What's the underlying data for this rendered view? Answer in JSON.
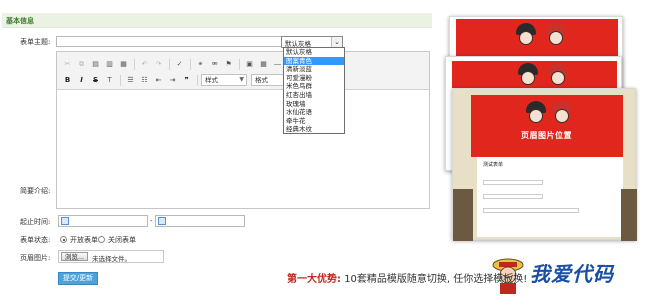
{
  "section": {
    "title": "基本信息"
  },
  "labels": {
    "form_title": "表单主题:",
    "intro": "简要介绍:",
    "time": "起止时间:",
    "status": "表单状态:",
    "header_image": "页眉图片:"
  },
  "theme_select": {
    "value": "默认灰格",
    "options": [
      "默认灰格",
      "图案青色",
      "清新淡蓝",
      "可爱漫粉",
      "米色鸟群",
      "红杏出墙",
      "玫瑰墙",
      "水仙花语",
      "牵牛花",
      "经典木纹"
    ],
    "highlighted_index": 1
  },
  "editor": {
    "style_combo": "样式",
    "format_combo": "格式",
    "font_color_label": "A"
  },
  "date_separator": "-",
  "status_options": [
    {
      "label": "开放表单",
      "checked": true
    },
    {
      "label": "关闭表单",
      "checked": false
    }
  ],
  "file": {
    "button": "浏览...",
    "no_file": "未选择文件。"
  },
  "submit": "提交/更新",
  "preview": {
    "caption": "页眉图片位置",
    "form_title": "测试表单"
  },
  "slogan": {
    "key": "第一大优势:",
    "text": "10套精品模版随意切换, 任你选择模板换!"
  },
  "watermark": "我爱代码",
  "colors": {
    "accent": "#3c7a2f",
    "highlight": "#3399ff",
    "button": "#4aa3df",
    "red": "#e1261d",
    "slogan_key": "#c0281e"
  }
}
